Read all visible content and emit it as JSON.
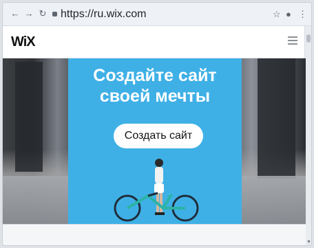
{
  "browser": {
    "url": "https://ru.wix.com",
    "icons": {
      "back": "arrow-left",
      "forward": "arrow-right",
      "reload": "reload",
      "lock": "lock",
      "star": "star",
      "account": "account",
      "menu": "kebab-menu"
    }
  },
  "site": {
    "logo": "WiX",
    "hero": {
      "headline_line1": "Создайте сайт",
      "headline_line2": "своей мечты",
      "cta_label": "Создать сайт"
    },
    "colors": {
      "panel": "#3fb0e6",
      "button_bg": "#ffffff"
    }
  }
}
